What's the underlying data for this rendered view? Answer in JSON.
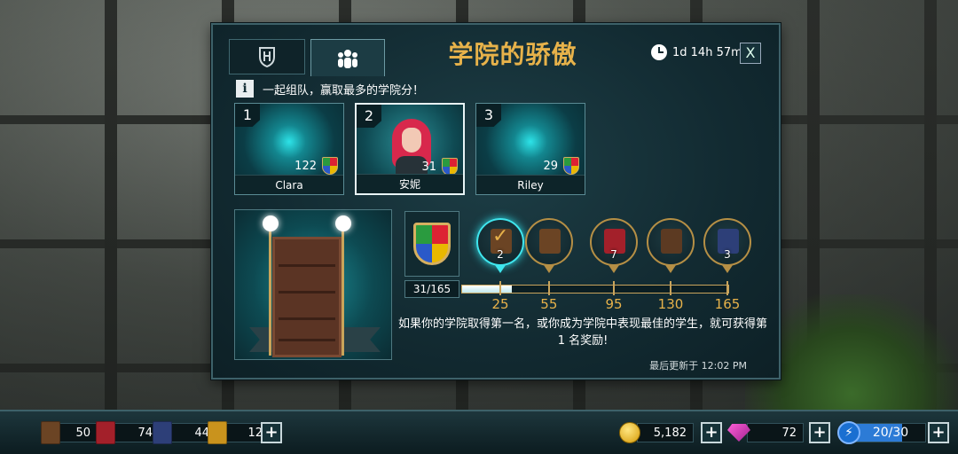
{
  "header": {
    "title": "学院的骄傲",
    "timer": "1d 14h 57m",
    "close_label": "X",
    "info_text": "一起组队，赢取最多的学院分！",
    "info_icon": "i"
  },
  "tabs": [
    {
      "icon": "house-crest-icon"
    },
    {
      "icon": "team-people-icon"
    }
  ],
  "team": [
    {
      "rank": "1",
      "name": "Clara",
      "score": "122",
      "has_avatar": false
    },
    {
      "rank": "2",
      "name": "安妮",
      "score": "31",
      "has_avatar": true
    },
    {
      "rank": "3",
      "name": "Riley",
      "score": "29",
      "has_avatar": false
    }
  ],
  "progress": {
    "label": "31/165",
    "current": 31,
    "max": 165,
    "thresholds": [
      "25",
      "55",
      "95",
      "130",
      "165"
    ]
  },
  "rewards": [
    {
      "item": "brown-book-claimed",
      "count": "2",
      "color": "#6b4424"
    },
    {
      "item": "brown-book",
      "count": "",
      "color": "#6b4424"
    },
    {
      "item": "red-book",
      "count": "7",
      "color": "#a3202a"
    },
    {
      "item": "brown-book",
      "count": "",
      "color": "#5c3a22"
    },
    {
      "item": "blue-book",
      "count": "3",
      "color": "#2d3f78"
    }
  ],
  "description": "如果你的学院取得第一名，或你成为学院中表现最佳的学生，就可获得第 1 名奖励!",
  "last_updated": "最后更新于 12:02 PM",
  "bottom_bar": {
    "books": [
      {
        "icon": "brown-book-icon",
        "count": "50",
        "color": "#6b4424"
      },
      {
        "icon": "red-book-icon",
        "count": "74",
        "color": "#a3202a"
      },
      {
        "icon": "blue-book-icon",
        "count": "44",
        "color": "#2d3f78"
      },
      {
        "icon": "gold-book-icon",
        "count": "12",
        "color": "#c9931d"
      }
    ],
    "coins": "5,182",
    "gems": "72",
    "energy": "20/30",
    "energy_level": 0.667,
    "plus_label": "+"
  },
  "colors": {
    "accent_gold": "#e7b24a",
    "panel_bg": "#122a31",
    "highlight_cyan": "#3fe6ee"
  }
}
